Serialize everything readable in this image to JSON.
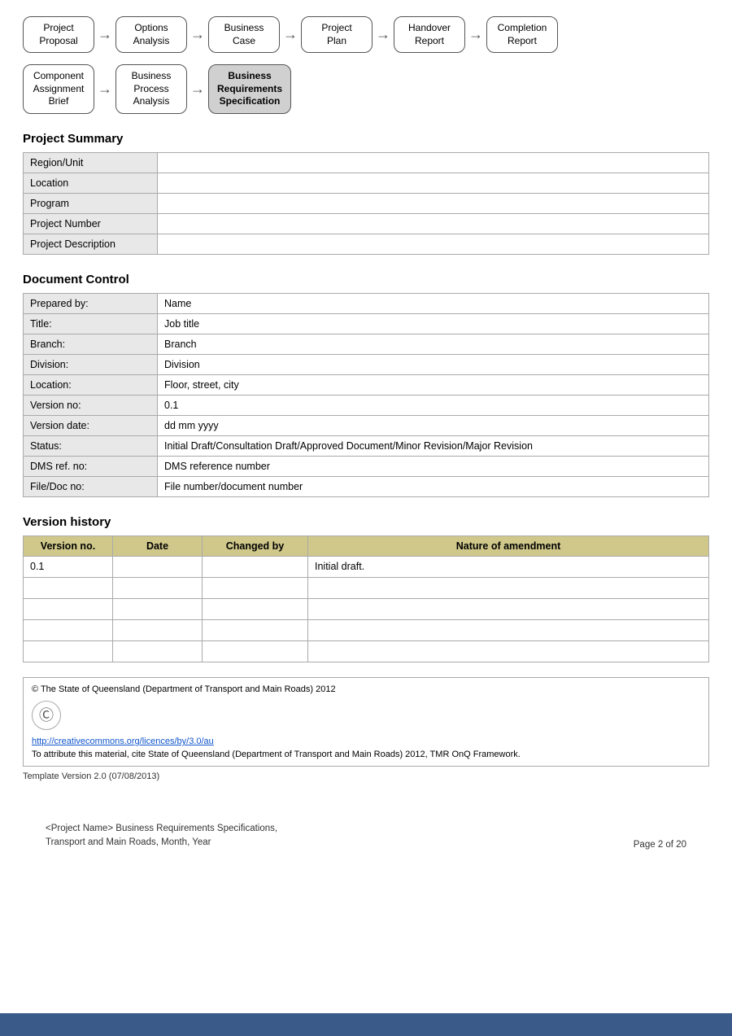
{
  "flow1": {
    "boxes": [
      {
        "label": "Project\nProposal",
        "active": false
      },
      {
        "label": "Options\nAnalysis",
        "active": false
      },
      {
        "label": "Business\nCase",
        "active": false
      },
      {
        "label": "Project\nPlan",
        "active": false
      },
      {
        "label": "Handover\nReport",
        "active": false
      },
      {
        "label": "Completion\nReport",
        "active": false
      }
    ]
  },
  "flow2": {
    "boxes": [
      {
        "label": "Component\nAssignment\nBrief",
        "active": false
      },
      {
        "label": "Business\nProcess\nAnalysis",
        "active": false
      },
      {
        "label": "Business\nRequirements\nSpecification",
        "active": true
      }
    ]
  },
  "project_summary": {
    "title": "Project Summary",
    "rows": [
      {
        "label": "Region/Unit",
        "value": ""
      },
      {
        "label": "Location",
        "value": ""
      },
      {
        "label": "Program",
        "value": ""
      },
      {
        "label": "Project Number",
        "value": ""
      },
      {
        "label": "Project Description",
        "value": ""
      }
    ]
  },
  "document_control": {
    "title": "Document Control",
    "rows": [
      {
        "label": "Prepared by:",
        "value": "Name"
      },
      {
        "label": "Title:",
        "value": "Job title"
      },
      {
        "label": "Branch:",
        "value": "Branch"
      },
      {
        "label": "Division:",
        "value": "Division"
      },
      {
        "label": "Location:",
        "value": "Floor, street, city"
      },
      {
        "label": "Version no:",
        "value": "0.1"
      },
      {
        "label": "Version date:",
        "value": "dd mm yyyy"
      },
      {
        "label": "Status:",
        "value": "Initial Draft/Consultation Draft/Approved Document/Minor Revision/Major Revision"
      },
      {
        "label": "DMS ref. no:",
        "value": "DMS reference number"
      },
      {
        "label": "File/Doc no:",
        "value": "File number/document number"
      }
    ]
  },
  "version_history": {
    "title": "Version history",
    "headers": [
      "Version no.",
      "Date",
      "Changed by",
      "Nature of amendment"
    ],
    "rows": [
      {
        "version": "0.1",
        "date": "",
        "changed_by": "",
        "amendment": "Initial draft."
      },
      {
        "version": "",
        "date": "",
        "changed_by": "",
        "amendment": ""
      },
      {
        "version": "",
        "date": "",
        "changed_by": "",
        "amendment": ""
      },
      {
        "version": "",
        "date": "",
        "changed_by": "",
        "amendment": ""
      },
      {
        "version": "",
        "date": "",
        "changed_by": "",
        "amendment": ""
      }
    ]
  },
  "footer": {
    "copyright": "© The State of Queensland (Department of Transport and Main Roads) 2012",
    "cc_symbol": "©",
    "link_text": "http://creativecommons.org/licences/by/3.0/au",
    "attribution": "To attribute this material, cite State of Queensland (Department of Transport and Main Roads) 2012, TMR OnQ Framework.",
    "template_version": "Template Version 2.0 (07/08/2013)"
  },
  "bottom": {
    "left_line1": "<Project Name> Business Requirements Specifications,",
    "left_line2": "Transport and Main Roads, Month, Year",
    "right": "Page 2 of 20"
  }
}
